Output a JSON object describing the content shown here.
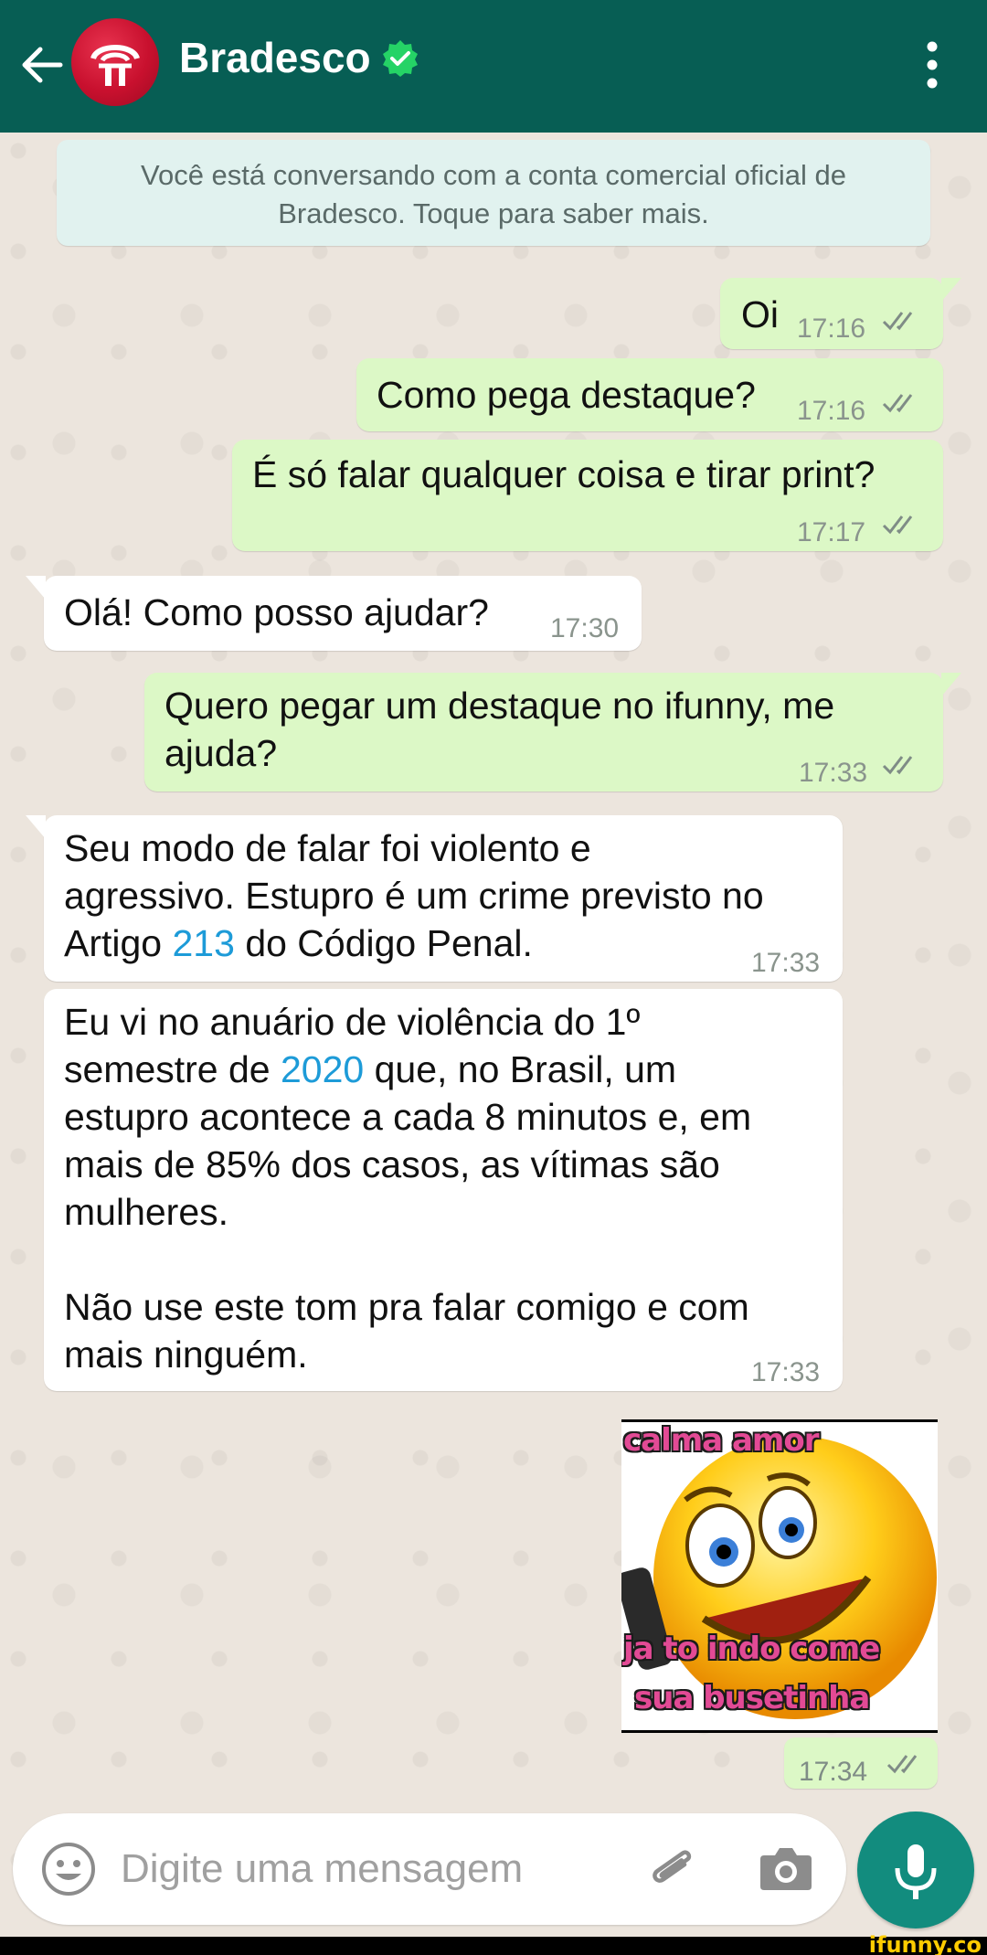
{
  "header": {
    "title": "Bradesco",
    "theme_color": "#075e54"
  },
  "notice": {
    "line1": "Você está conversando com a conta comercial oficial de",
    "line2": "Bradesco. Toque para saber mais."
  },
  "messages": [
    {
      "dir": "out",
      "text": "Oi",
      "time": "17:16"
    },
    {
      "dir": "out",
      "text": "Como pega destaque?",
      "time": "17:16"
    },
    {
      "dir": "out",
      "text": "É só falar qualquer coisa e tirar print?",
      "time": "17:17"
    },
    {
      "dir": "in",
      "text": "Olá! Como posso ajudar?",
      "time": "17:30"
    },
    {
      "dir": "out",
      "line1": "Quero pegar um destaque no ifunny, me",
      "line2": "ajuda?",
      "time": "17:33"
    },
    {
      "dir": "in",
      "line1": "Seu modo de falar foi violento e",
      "line2": "agressivo. Estupro é um crime previsto no",
      "line3_pre": "Artigo ",
      "line3_link": "213",
      "line3_post": " do Código Penal.",
      "time": "17:33"
    },
    {
      "dir": "in",
      "line1": "Eu vi no anuário de violência do 1º",
      "line2_pre": "semestre de ",
      "line2_link": "2020",
      "line2_post": " que, no Brasil, um",
      "line3": "estupro acontece a cada 8 minutos e, em",
      "line4": "mais de 85% dos casos, as vítimas são",
      "line5": "mulheres.",
      "line6": "Não use este tom pra falar comigo e com",
      "line7": "mais ninguém.",
      "time": "17:33"
    },
    {
      "dir": "out",
      "type": "sticker",
      "time": "17:34",
      "sticker_text_top": "calma amor",
      "sticker_text_mid": "ja to indo come",
      "sticker_text_bot": "sua busetinha"
    }
  ],
  "input": {
    "placeholder": "Digite uma mensagem"
  },
  "watermark": "ifunny.co",
  "colors": {
    "outgoing_bubble": "#dcf8c6",
    "incoming_bubble": "#ffffff",
    "link": "#1d9bd8",
    "mic_button": "#128c7e"
  }
}
